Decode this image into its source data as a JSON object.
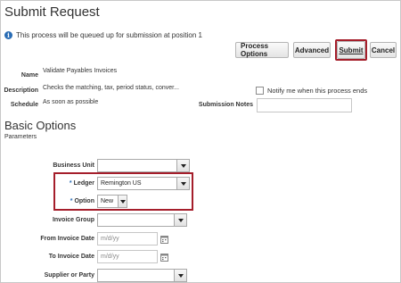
{
  "page": {
    "title": "Submit Request",
    "info_message": "This process will be queued up for submission at position 1"
  },
  "toolbar": {
    "process_options_label": "Process Options",
    "advanced_label": "Advanced",
    "submit_label": "Submit",
    "cancel_label": "Cancel"
  },
  "details": {
    "name_label": "Name",
    "name_value": "Validate Payables Invoices",
    "description_label": "Description",
    "description_value": "Checks the matching, tax, period status, conver...",
    "schedule_label": "Schedule",
    "schedule_value": "As soon as possible",
    "notify_label": "Notify me when this process ends",
    "notify_checked": false,
    "submission_notes_label": "Submission Notes",
    "submission_notes_value": ""
  },
  "basic_options": {
    "title": "Basic Options",
    "subtitle": "Parameters",
    "fields": {
      "business_unit": {
        "label": "Business Unit",
        "value": ""
      },
      "ledger": {
        "label": "Ledger",
        "value": "Remington US",
        "required_mark": "*"
      },
      "option": {
        "label": "Option",
        "value": "New",
        "required_mark": "*"
      },
      "invoice_group": {
        "label": "Invoice Group",
        "value": ""
      },
      "from_invoice_date": {
        "label": "From Invoice Date",
        "placeholder": "m/d/yy"
      },
      "to_invoice_date": {
        "label": "To Invoice Date",
        "placeholder": "m/d/yy"
      },
      "supplier_or_party": {
        "label": "Supplier or Party",
        "value": ""
      }
    }
  },
  "colors": {
    "highlight": "#a51e2b",
    "info_blue": "#2a6db5"
  },
  "icons": {
    "info": "info-icon",
    "calendar": "calendar-icon",
    "dropdown": "chevron-down-icon"
  }
}
